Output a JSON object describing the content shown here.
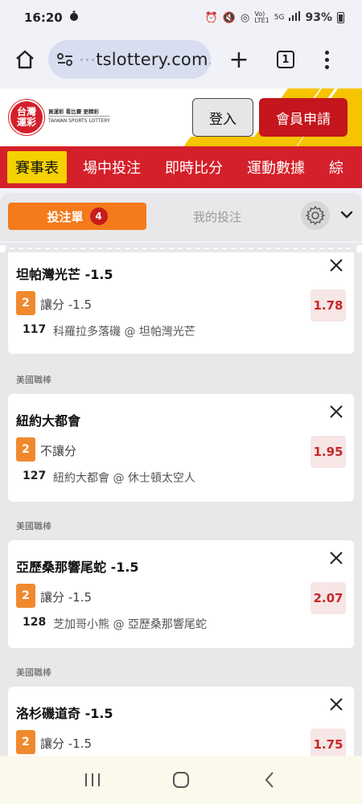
{
  "status_bar": {
    "time": "16:20",
    "battery": "93%",
    "net_label": "5G"
  },
  "browser": {
    "url_faded": "⋯",
    "url_main": "tslottery.com.tw",
    "tab_count": "1"
  },
  "site": {
    "logo_line1": "台灣",
    "logo_line2": "運彩",
    "tagline_cn": "買運彩 看比賽 更精彩",
    "tagline_en": "TAIWAN SPORTS LOTTERY",
    "login_label": "登入",
    "register_label": "會員申請"
  },
  "nav": {
    "items": [
      "賽事表",
      "場中投注",
      "即時比分",
      "運動數據",
      "綜"
    ]
  },
  "slip": {
    "tab_active": "投注單",
    "count": "4",
    "tab_mine": "我的投注"
  },
  "bets": [
    {
      "title": "坦帕灣光芒 -1.5",
      "num": "2",
      "type": "讓分 -1.5",
      "odds": "1.78",
      "match_no": "117",
      "match": "科羅拉多落磯 @ 坦帕灣光芒"
    },
    {
      "league": "美國職棒",
      "title": "紐約大都會",
      "num": "2",
      "type": "不讓分",
      "odds": "1.95",
      "match_no": "127",
      "match": "紐約大都會 @ 休士頓太空人"
    },
    {
      "league": "美國職棒",
      "title": "亞歷桑那響尾蛇 -1.5",
      "num": "2",
      "type": "讓分 -1.5",
      "odds": "2.07",
      "match_no": "128",
      "match": "芝加哥小熊 @ 亞歷桑那響尾蛇"
    },
    {
      "league": "美國職棒",
      "title": "洛杉磯道奇 -1.5",
      "num": "2",
      "type": "讓分 -1.5",
      "odds": "1.75"
    }
  ],
  "colors": {
    "brand_red": "#d4202a",
    "accent_orange": "#f47a1b",
    "highlight_yellow": "#f6d100",
    "odds_red": "#c62828"
  }
}
